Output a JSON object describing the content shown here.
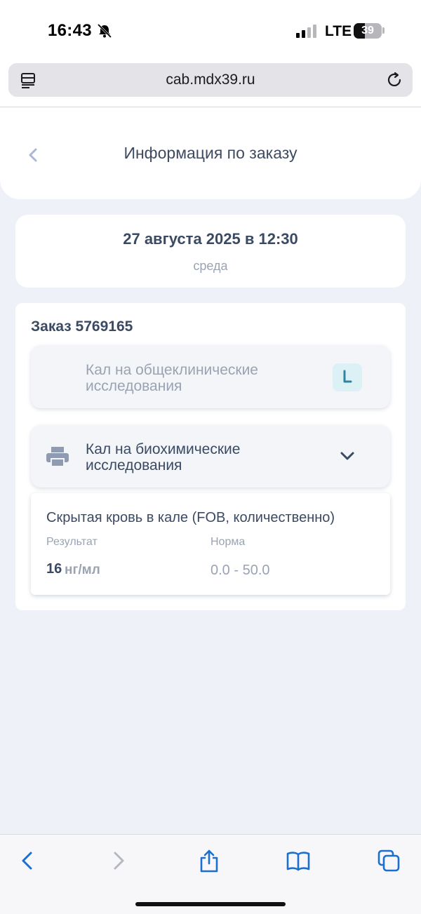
{
  "status_bar": {
    "time": "16:43",
    "network": "LTE",
    "battery_percent": "39",
    "battery_level": 0.39
  },
  "browser": {
    "url": "cab.mdx39.ru",
    "icons": [
      "reader-icon",
      "reload-icon",
      "back-icon",
      "forward-icon",
      "share-icon",
      "bookmarks-icon",
      "tabs-icon"
    ]
  },
  "header": {
    "title": "Информация по заказу"
  },
  "date_card": {
    "date": "27 августа 2025 в 12:30",
    "weekday": "среда"
  },
  "order": {
    "title": "Заказ 5769165",
    "tests": [
      {
        "name": "Кал на общеклинические исследования",
        "status_icon": "clock-icon"
      },
      {
        "name": "Кал на биохимические исследования",
        "status_icon": "printer-icon"
      }
    ],
    "result": {
      "name": "Скрытая кровь в кале (FOB, количественно)",
      "result_label": "Результат",
      "norm_label": "Норма",
      "value": "16",
      "unit": "нг/мл",
      "norm": "0.0 - 50.0"
    }
  },
  "colors": {
    "accent": "#3b4a63",
    "muted": "#9aa3b2",
    "browser_blue": "#1a6fd1",
    "background": "#eef1f7"
  }
}
